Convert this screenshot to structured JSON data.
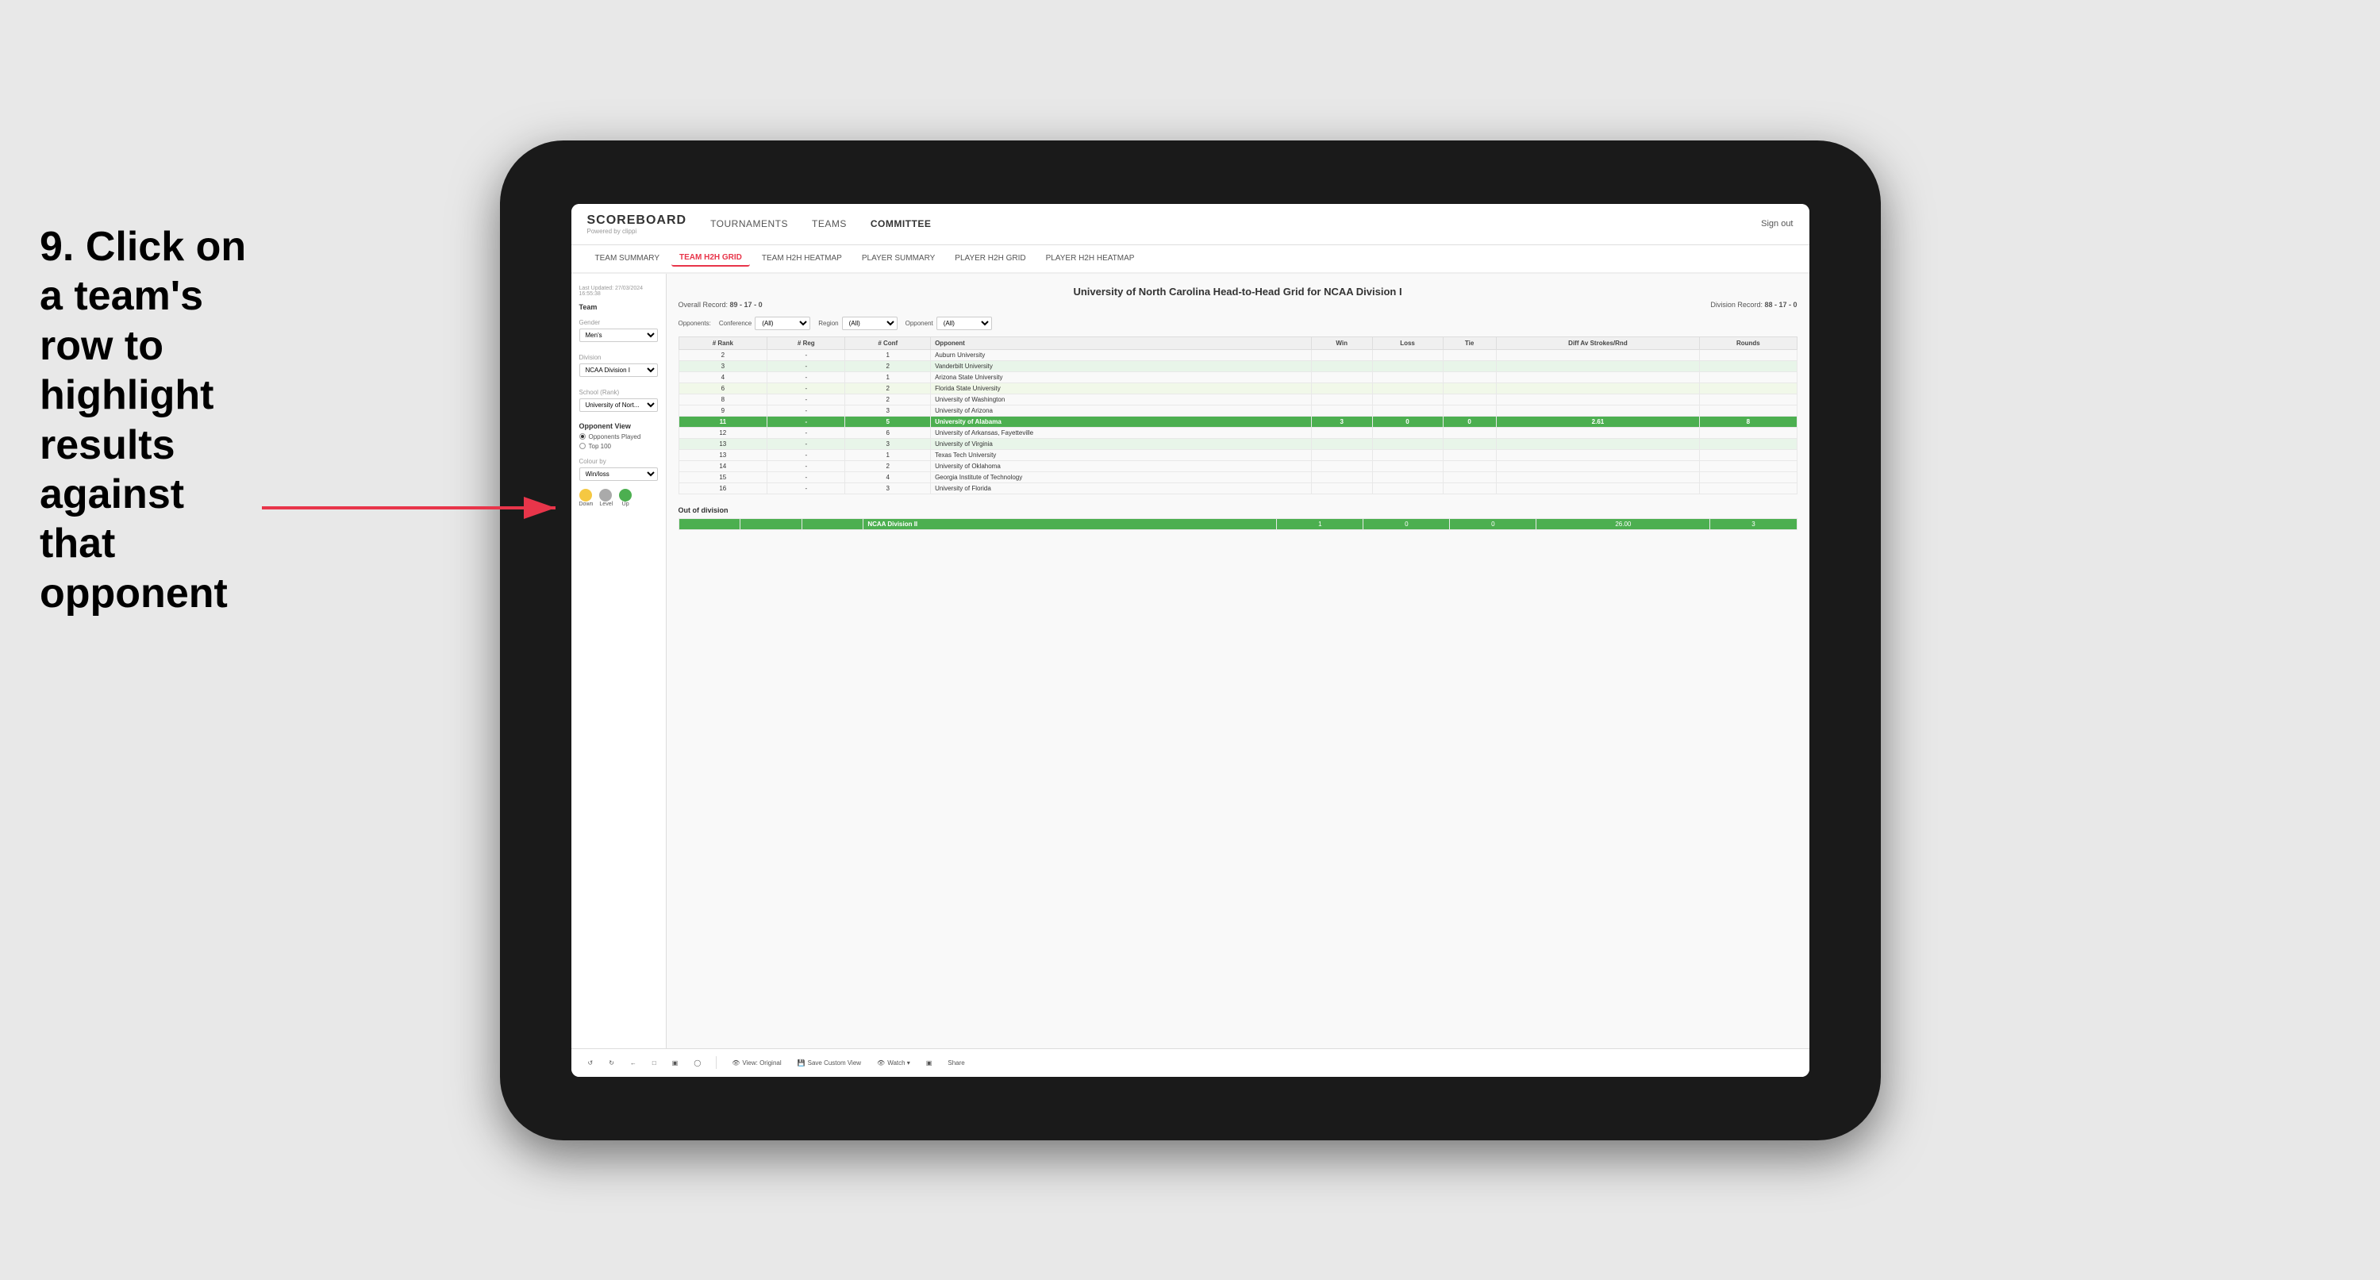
{
  "instruction": {
    "number": "9.",
    "text": "Click on a team's row to highlight results against that opponent"
  },
  "nav": {
    "logo": "SCOREBOARD",
    "logo_sub": "Powered by clippi",
    "items": [
      "TOURNAMENTS",
      "TEAMS",
      "COMMITTEE"
    ],
    "sign_out": "Sign out"
  },
  "sub_nav": {
    "items": [
      "TEAM SUMMARY",
      "TEAM H2H GRID",
      "TEAM H2H HEATMAP",
      "PLAYER SUMMARY",
      "PLAYER H2H GRID",
      "PLAYER H2H HEATMAP"
    ],
    "active": "TEAM H2H GRID"
  },
  "sidebar": {
    "last_updated_label": "Last Updated: 27/03/2024",
    "last_updated_time": "16:55:38",
    "team_label": "Team",
    "gender_label": "Gender",
    "gender_value": "Men's",
    "division_label": "Division",
    "division_value": "NCAA Division I",
    "school_label": "School (Rank)",
    "school_value": "University of Nort...",
    "opponent_view_label": "Opponent View",
    "opponents_played_label": "Opponents Played",
    "top100_label": "Top 100",
    "colour_by_label": "Colour by",
    "colour_by_value": "Win/loss",
    "legend": {
      "down_label": "Down",
      "level_label": "Level",
      "up_label": "Up"
    }
  },
  "grid": {
    "title": "University of North Carolina Head-to-Head Grid for NCAA Division I",
    "overall_record_label": "Overall Record:",
    "overall_record": "89 - 17 - 0",
    "division_record_label": "Division Record:",
    "division_record": "88 - 17 - 0",
    "filters": {
      "opponents_label": "Opponents:",
      "conference_label": "Conference",
      "conference_value": "(All)",
      "region_label": "Region",
      "region_value": "(All)",
      "opponent_label": "Opponent",
      "opponent_value": "(All)"
    },
    "columns": [
      "# Rank",
      "# Reg",
      "# Conf",
      "Opponent",
      "Win",
      "Loss",
      "Tie",
      "Diff Av Strokes/Rnd",
      "Rounds"
    ],
    "rows": [
      {
        "rank": "2",
        "reg": "-",
        "conf": "1",
        "opponent": "Auburn University",
        "win": "",
        "loss": "",
        "tie": "",
        "diff": "",
        "rounds": "",
        "style": "normal"
      },
      {
        "rank": "3",
        "reg": "-",
        "conf": "2",
        "opponent": "Vanderbilt University",
        "win": "",
        "loss": "",
        "tie": "",
        "diff": "",
        "rounds": "",
        "style": "light-green"
      },
      {
        "rank": "4",
        "reg": "-",
        "conf": "1",
        "opponent": "Arizona State University",
        "win": "",
        "loss": "",
        "tie": "",
        "diff": "",
        "rounds": "",
        "style": "normal"
      },
      {
        "rank": "6",
        "reg": "-",
        "conf": "2",
        "opponent": "Florida State University",
        "win": "",
        "loss": "",
        "tie": "",
        "diff": "",
        "rounds": "",
        "style": "very-light-green"
      },
      {
        "rank": "8",
        "reg": "-",
        "conf": "2",
        "opponent": "University of Washington",
        "win": "",
        "loss": "",
        "tie": "",
        "diff": "",
        "rounds": "",
        "style": "normal"
      },
      {
        "rank": "9",
        "reg": "-",
        "conf": "3",
        "opponent": "University of Arizona",
        "win": "",
        "loss": "",
        "tie": "",
        "diff": "",
        "rounds": "",
        "style": "normal"
      },
      {
        "rank": "11",
        "reg": "-",
        "conf": "5",
        "opponent": "University of Alabama",
        "win": "3",
        "loss": "0",
        "tie": "0",
        "diff": "2.61",
        "rounds": "8",
        "style": "highlighted"
      },
      {
        "rank": "12",
        "reg": "-",
        "conf": "6",
        "opponent": "University of Arkansas, Fayetteville",
        "win": "",
        "loss": "",
        "tie": "",
        "diff": "",
        "rounds": "",
        "style": "normal"
      },
      {
        "rank": "13",
        "reg": "-",
        "conf": "3",
        "opponent": "University of Virginia",
        "win": "",
        "loss": "",
        "tie": "",
        "diff": "",
        "rounds": "",
        "style": "light-green"
      },
      {
        "rank": "13",
        "reg": "-",
        "conf": "1",
        "opponent": "Texas Tech University",
        "win": "",
        "loss": "",
        "tie": "",
        "diff": "",
        "rounds": "",
        "style": "normal"
      },
      {
        "rank": "14",
        "reg": "-",
        "conf": "2",
        "opponent": "University of Oklahoma",
        "win": "",
        "loss": "",
        "tie": "",
        "diff": "",
        "rounds": "",
        "style": "normal"
      },
      {
        "rank": "15",
        "reg": "-",
        "conf": "4",
        "opponent": "Georgia Institute of Technology",
        "win": "",
        "loss": "",
        "tie": "",
        "diff": "",
        "rounds": "",
        "style": "normal"
      },
      {
        "rank": "16",
        "reg": "-",
        "conf": "3",
        "opponent": "University of Florida",
        "win": "",
        "loss": "",
        "tie": "",
        "diff": "",
        "rounds": "",
        "style": "normal"
      }
    ],
    "out_of_division": {
      "title": "Out of division",
      "row": {
        "label": "NCAA Division II",
        "win": "1",
        "loss": "0",
        "tie": "0",
        "diff": "26.00",
        "rounds": "3"
      }
    }
  },
  "toolbar": {
    "buttons": [
      "View: Original",
      "Save Custom View",
      "Watch ▾",
      "Share"
    ]
  }
}
